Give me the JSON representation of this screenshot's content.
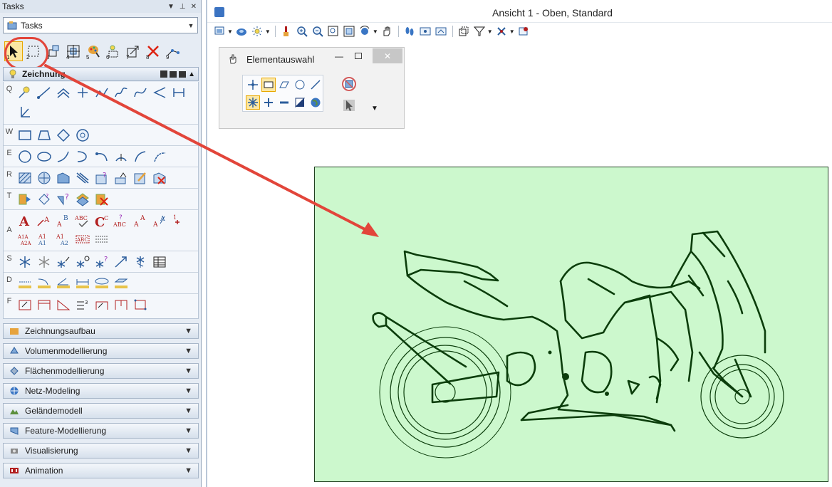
{
  "tasks_panel": {
    "title": "Tasks",
    "combo_value": "Tasks",
    "main_tools": [
      {
        "num": "1",
        "icon": "arrow-pointer-icon"
      },
      {
        "num": "2",
        "icon": "selection-rectangle-icon"
      },
      {
        "num": "3",
        "icon": "move-icon"
      },
      {
        "num": "4",
        "icon": "scale-icon"
      },
      {
        "num": "5",
        "icon": "paint-icon"
      },
      {
        "num": "6",
        "icon": "copy-icon"
      },
      {
        "num": "7",
        "icon": "rotate-icon"
      },
      {
        "num": "8",
        "icon": "delete-icon"
      },
      {
        "num": "9",
        "icon": "modify-icon"
      }
    ],
    "section_label": "Zeichnung",
    "row_keys": [
      "Q",
      "W",
      "E",
      "R",
      "T",
      "A",
      "S",
      "D",
      "F"
    ],
    "accordion": [
      {
        "label": "Zeichnungsaufbau",
        "icon": "drawing-setup-icon"
      },
      {
        "label": "Volumenmodellierung",
        "icon": "solid-modeling-icon"
      },
      {
        "label": "Flächenmodellierung",
        "icon": "surface-modeling-icon"
      },
      {
        "label": "Netz-Modeling",
        "icon": "mesh-modeling-icon"
      },
      {
        "label": "Geländemodell",
        "icon": "terrain-model-icon"
      },
      {
        "label": "Feature-Modellierung",
        "icon": "feature-modeling-icon"
      },
      {
        "label": "Visualisierung",
        "icon": "visualization-icon"
      },
      {
        "label": "Animation",
        "icon": "animation-icon"
      }
    ]
  },
  "view_window": {
    "title": "Ansicht 1 - Oben, Standard"
  },
  "element_dialog": {
    "title": "Elementauswahl"
  },
  "colors": {
    "canvas_bg": "#ccf8cd",
    "drawing_line": "#0b3d0b",
    "annotation_red": "#e2453a",
    "selection_yellow": "#fbe7a4"
  }
}
